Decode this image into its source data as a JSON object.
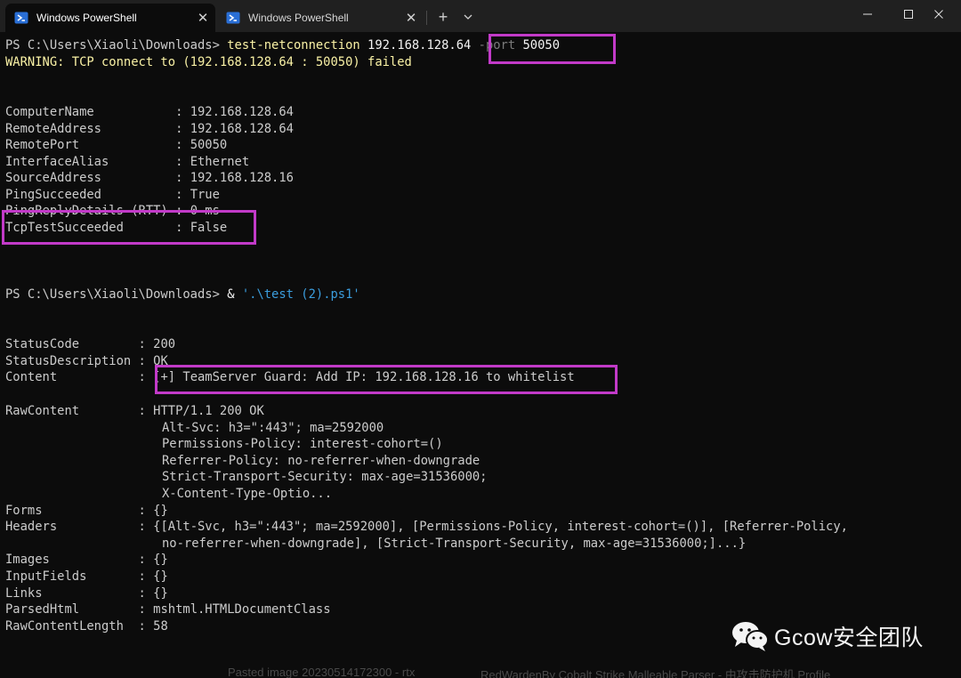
{
  "tabs": [
    {
      "title": "Windows PowerShell",
      "active": true
    },
    {
      "title": "Windows PowerShell",
      "active": false
    }
  ],
  "titlebar": {
    "new_tab_glyph": "+",
    "dropdown_glyph": "⌄",
    "close_glyph": "✕"
  },
  "terminal": {
    "prompt1": "PS C:\\Users\\Xiaoli\\Downloads> ",
    "cmd1": "test-netconnection",
    "cmd1_host": " 192.168.128.64 ",
    "cmd1_param": "-port",
    "cmd1_port": " 50050",
    "warning": "WARNING: TCP connect to (192.168.128.64 : 50050) failed",
    "netresult": [
      {
        "key": "ComputerName           ",
        "sep": ": ",
        "value": "192.168.128.64"
      },
      {
        "key": "RemoteAddress          ",
        "sep": ": ",
        "value": "192.168.128.64"
      },
      {
        "key": "RemotePort             ",
        "sep": ": ",
        "value": "50050"
      },
      {
        "key": "InterfaceAlias         ",
        "sep": ": ",
        "value": "Ethernet"
      },
      {
        "key": "SourceAddress          ",
        "sep": ": ",
        "value": "192.168.128.16"
      },
      {
        "key": "PingSucceeded          ",
        "sep": ": ",
        "value": "True"
      },
      {
        "key": "PingReplyDetails (RTT) ",
        "sep": ": ",
        "value": "0 ms"
      },
      {
        "key": "TcpTestSucceeded       ",
        "sep": ": ",
        "value": "False"
      }
    ],
    "prompt2": "PS C:\\Users\\Xiaoli\\Downloads> ",
    "cmd2_op": "& ",
    "cmd2_arg": "'.\\test (2).ps1'",
    "webresult": [
      {
        "key": "StatusCode        ",
        "sep": ": ",
        "value": "200"
      },
      {
        "key": "StatusDescription ",
        "sep": ": ",
        "value": "OK"
      },
      {
        "key": "Content           ",
        "sep": ": ",
        "value": "[+] TeamServer Guard: Add IP: 192.168.128.16 to whitelist"
      }
    ],
    "rawcontent_key": "RawContent        ",
    "rawcontent_sep": ": ",
    "rawcontent_lines": [
      "HTTP/1.1 200 OK",
      "Alt-Svc: h3=\":443\"; ma=2592000",
      "Permissions-Policy: interest-cohort=()",
      "Referrer-Policy: no-referrer-when-downgrade",
      "Strict-Transport-Security: max-age=31536000;",
      "X-Content-Type-Optio..."
    ],
    "forms": {
      "key": "Forms             ",
      "sep": ": ",
      "value": "{}"
    },
    "headers_key": "Headers           ",
    "headers_sep": ": ",
    "headers_lines": [
      "{[Alt-Svc, h3=\":443\"; ma=2592000], [Permissions-Policy, interest-cohort=()], [Referrer-Policy,",
      "no-referrer-when-downgrade], [Strict-Transport-Security, max-age=31536000;]...}"
    ],
    "tail": [
      {
        "key": "Images            ",
        "sep": ": ",
        "value": "{}"
      },
      {
        "key": "InputFields       ",
        "sep": ": ",
        "value": "{}"
      },
      {
        "key": "Links             ",
        "sep": ": ",
        "value": "{}"
      },
      {
        "key": "ParsedHtml        ",
        "sep": ": ",
        "value": "mshtml.HTMLDocumentClass"
      },
      {
        "key": "RawContentLength  ",
        "sep": ": ",
        "value": "58"
      }
    ]
  },
  "bottom_ghost": {
    "left": "Pasted image 20230514172300 - rtx",
    "right": "RedWardenBy Cobalt Strike Malleable Parser - 由攻击防护机 Profile"
  },
  "watermark": {
    "text": "Gcow安全团队"
  },
  "colors": {
    "terminal_bg": "#0c0c0c",
    "titlebar_bg": "#202020",
    "command": "#f9f1a5",
    "string": "#3b9ddd",
    "highlight_box": "#c23ac8"
  }
}
